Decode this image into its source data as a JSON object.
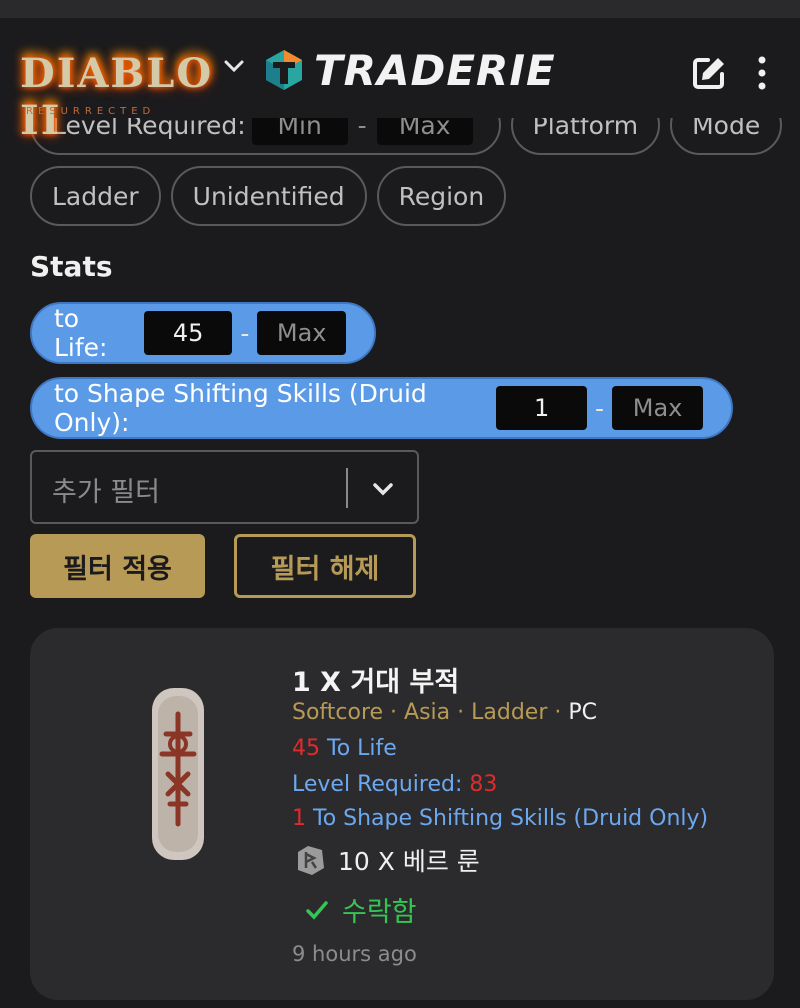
{
  "header": {
    "game_logo_text": "DIABLO II",
    "game_logo_subtitle": "RESURRECTED",
    "site_name": "TRADERIE"
  },
  "filters": {
    "level_required_label": "Level Required:",
    "level_min_placeholder": "Min",
    "level_max_placeholder": "Max",
    "range_dash": "-",
    "platform_label": "Platform",
    "mode_label": "Mode",
    "ladder_label": "Ladder",
    "unidentified_label": "Unidentified",
    "region_label": "Region"
  },
  "stats": {
    "title": "Stats",
    "items": [
      {
        "label": "to Life:",
        "min": "45",
        "max_placeholder": "Max"
      },
      {
        "label": "to Shape Shifting Skills (Druid Only):",
        "min": "1",
        "max_placeholder": "Max"
      }
    ]
  },
  "add_filter": {
    "placeholder": "추가 필터"
  },
  "buttons": {
    "apply": "필터 적용",
    "clear": "필터 해제"
  },
  "listing": {
    "title": "1 X 거대 부적",
    "meta": [
      "Softcore",
      "Asia",
      "Ladder",
      "PC"
    ],
    "meta_sep": " · ",
    "life_value": "45",
    "life_label": "To Life",
    "level_label": "Level Required:",
    "level_value": "83",
    "skill_value": "1",
    "skill_label": "To Shape Shifting Skills (Druid Only)",
    "price": "10 X 베르 룬",
    "status": "수락함",
    "time": "9 hours ago"
  },
  "colors": {
    "accent_gold": "#b79a56",
    "stat_blue": "#5b9ae6",
    "accepted_green": "#33c653",
    "value_red": "#e02b2b",
    "background": "#1b1b1d",
    "card": "#2b2b2e"
  }
}
